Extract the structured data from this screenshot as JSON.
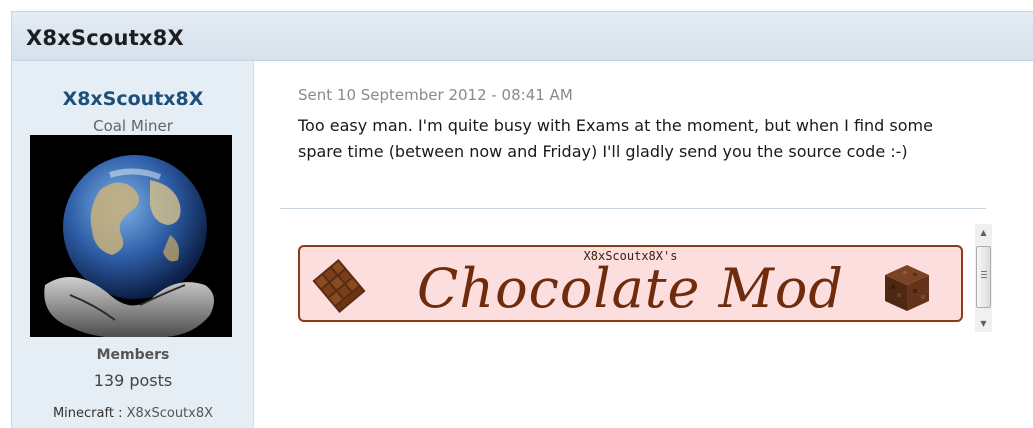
{
  "header": {
    "title": "X8xScoutx8X"
  },
  "author": {
    "name": "X8xScoutx8X",
    "rank": "Coal Miner",
    "avatar": "earth-in-hands-avatar",
    "group": "Members",
    "post_count": "139 posts",
    "custom_field": {
      "label": "Minecraft :",
      "value": "X8xScoutx8X"
    }
  },
  "post": {
    "date": "Sent 10 September 2012 - 08:41 AM",
    "text": "Too easy man. I'm quite busy with Exams at the moment, but when I find some spare time (between now and Friday) I'll gladly send you the source code :-)"
  },
  "signature": {
    "banner_subtitle": "X8xScoutx8X's",
    "banner_title": "Chocolate Mod",
    "left_icon": "chocolate-bar-icon",
    "right_icon": "chocolate-block-icon"
  },
  "scrollbar": {
    "up_icon": "▲",
    "down_icon": "▼"
  },
  "colors": {
    "header_bg": "#d5e1ec",
    "author_bg": "#e5edf5",
    "author_name": "#1d4f7a",
    "banner_bg": "#fddede",
    "banner_border": "#8b3b16",
    "banner_text": "#6e2c0c"
  }
}
